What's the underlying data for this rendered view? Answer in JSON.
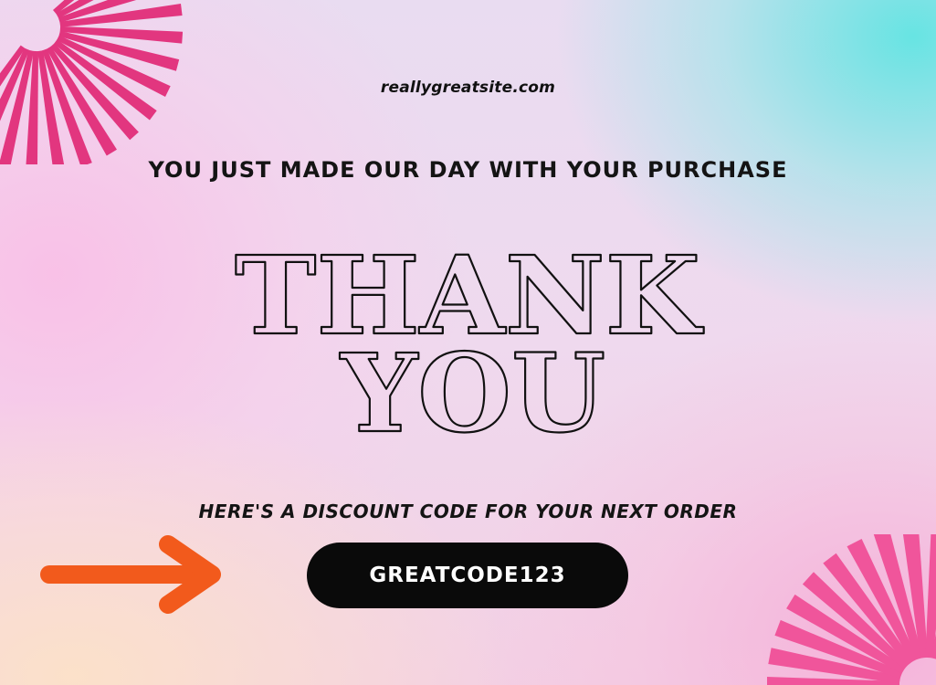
{
  "site": {
    "url": "reallygreatsite.com"
  },
  "headline": "YOU JUST MADE OUR DAY WITH YOUR PURCHASE",
  "hero": {
    "line1": "THANK",
    "line2": "YOU"
  },
  "discount": {
    "prompt": "HERE'S A DISCOUNT CODE FOR YOUR NEXT ORDER",
    "code": "GREATCODE123"
  },
  "colors": {
    "burst_top_left": "#e2367f",
    "burst_bottom_right": "#f0559b",
    "arrow": "#f25a1c",
    "pill_background": "#0a0a0a",
    "pill_text": "#ffffff",
    "accent_teal": "#60e4e2"
  },
  "icons": {
    "decor_top_left": "sunburst-icon",
    "decor_bottom_right": "sunburst-icon",
    "pointer": "arrow-right-icon"
  }
}
